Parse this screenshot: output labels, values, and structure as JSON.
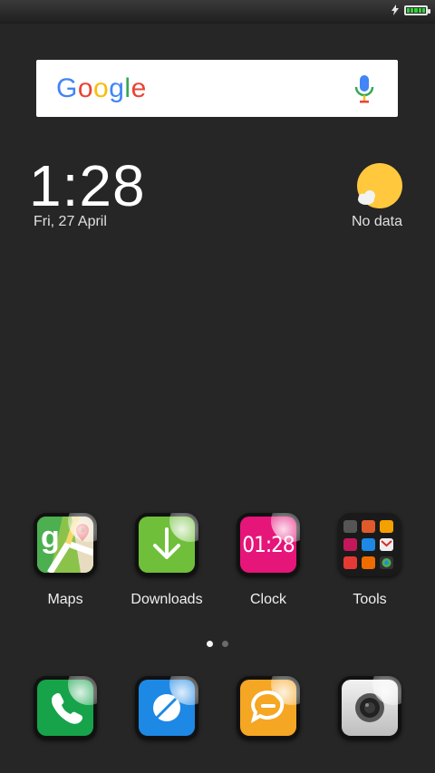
{
  "statusbar": {
    "battery_color": "#36d13b"
  },
  "search": {
    "logo_letters": [
      "G",
      "o",
      "o",
      "g",
      "l",
      "e"
    ],
    "logo_colors": [
      "#4285F4",
      "#EA4335",
      "#FBBC05",
      "#4285F4",
      "#34A853",
      "#EA4335"
    ]
  },
  "clock_widget": {
    "time": "1:28",
    "date": "Fri, 27 April"
  },
  "weather_widget": {
    "status": "No data"
  },
  "home_apps": [
    {
      "label": "Maps"
    },
    {
      "label": "Downloads"
    },
    {
      "label": "Clock",
      "icon_text": "01:28"
    },
    {
      "label": "Tools"
    }
  ],
  "page_indicator": {
    "pages": 2,
    "current": 1
  },
  "dock_apps": [
    {
      "name": "phone-app"
    },
    {
      "name": "browser-app"
    },
    {
      "name": "messaging-app"
    },
    {
      "name": "camera-app"
    }
  ],
  "colors": {
    "maps": "#6aa84f",
    "downloads": "#6fbf3a",
    "clock": "#e6157a",
    "phone": "#16a34a",
    "browser": "#1e88e5",
    "messaging": "#f5a623",
    "camera": "#d9d9d9"
  }
}
